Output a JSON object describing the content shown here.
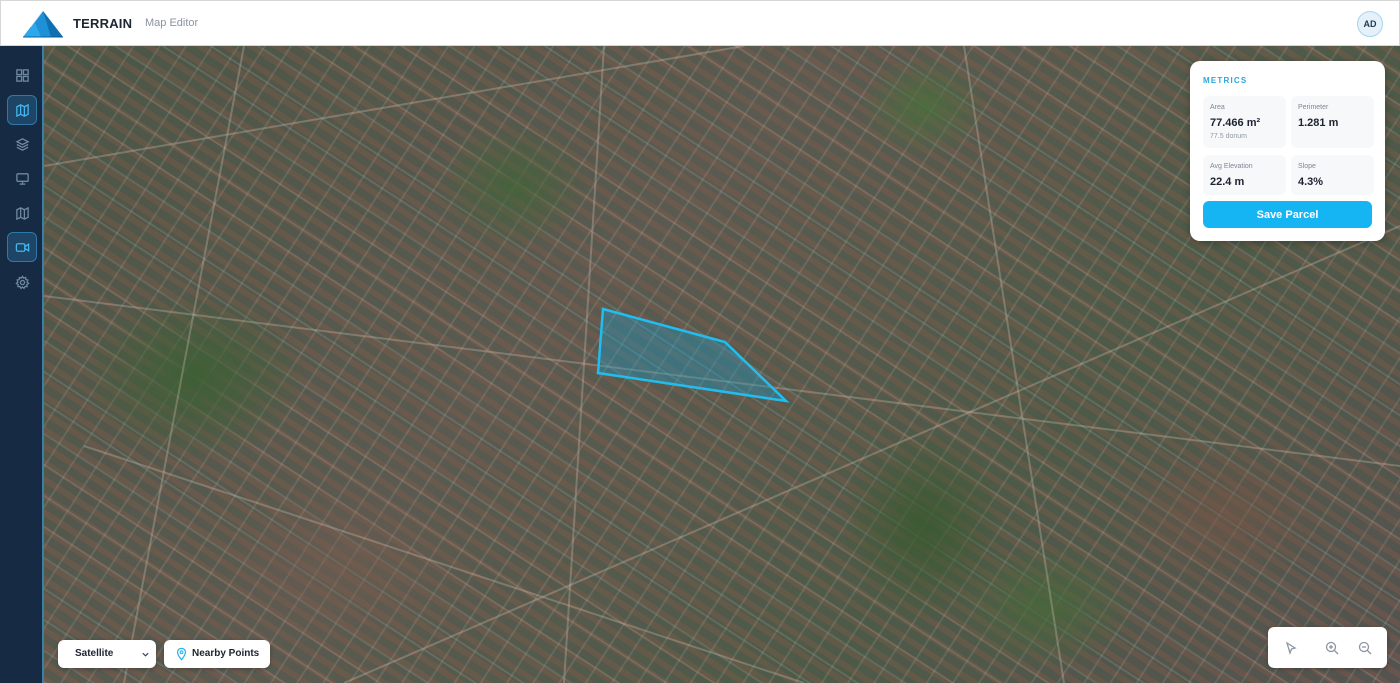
{
  "app": {
    "brand": "TERRAIN",
    "subtitle": "Map Editor",
    "avatar_initials": "AD",
    "accent_color": "#15b5f3"
  },
  "sidebar": {
    "items": [
      {
        "icon": "grid-icon",
        "active": false
      },
      {
        "icon": "map-icon",
        "active": true
      },
      {
        "icon": "layers-icon",
        "active": false
      },
      {
        "icon": "monitor-icon",
        "active": false
      },
      {
        "icon": "folded-map-icon",
        "active": false
      },
      {
        "icon": "video-camera-icon",
        "active": true
      },
      {
        "icon": "gear-icon",
        "active": false
      }
    ]
  },
  "metrics": {
    "title": "METRICS",
    "area": {
      "label": "Area",
      "value": "77.466 m²",
      "sub": "77.5 donum"
    },
    "perimeter": {
      "label": "Perimeter",
      "value": "1.281 m"
    },
    "elevation": {
      "label": "Avg Elevation",
      "value": "22.4 m"
    },
    "slope": {
      "label": "Slope",
      "value": "4.3%"
    },
    "save_label": "Save Parcel"
  },
  "map_controls": {
    "layer_select": {
      "selected": "Satellite"
    },
    "nearby_label": "Nearby Points",
    "tools": [
      "cursor-icon",
      "zoom-in-icon",
      "zoom-out-icon"
    ]
  },
  "map": {
    "type": "satellite",
    "parcel_color": "#1fb7ee"
  }
}
